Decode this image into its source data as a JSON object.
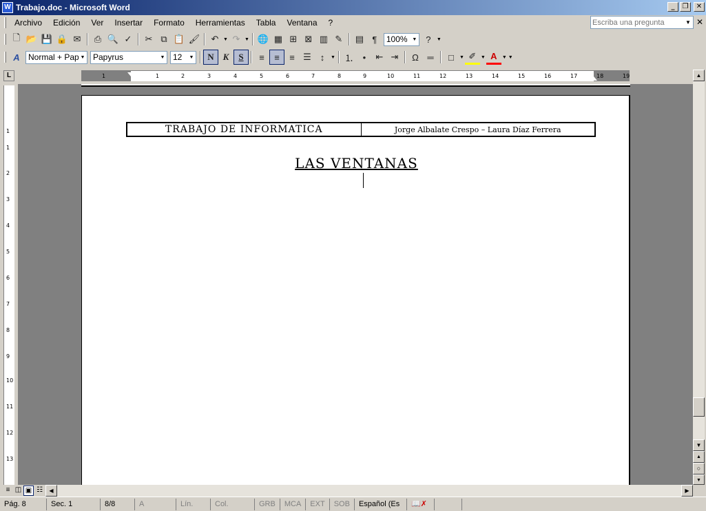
{
  "window": {
    "title": "Trabajo.doc - Microsoft Word",
    "app_icon": "W",
    "controls": {
      "minimize": "_",
      "restore": "❐",
      "close": "✕"
    }
  },
  "menu": {
    "items": [
      "Archivo",
      "Edición",
      "Ver",
      "Insertar",
      "Formato",
      "Herramientas",
      "Tabla",
      "Ventana",
      "?"
    ],
    "help_placeholder": "Escriba una pregunta",
    "doc_close": "✕"
  },
  "toolbar_standard": {
    "zoom": "100%"
  },
  "toolbar_format": {
    "style": "Normal + Papyr",
    "font": "Papyrus",
    "size": "12",
    "bold_label": "N",
    "italic_label": "K",
    "underline_label": "S"
  },
  "ruler": {
    "corner": "L",
    "marks": [
      "1",
      "1",
      "2",
      "3",
      "4",
      "5",
      "6",
      "7",
      "8",
      "9",
      "10",
      "11",
      "12",
      "13",
      "14",
      "15",
      "16",
      "17",
      "18",
      "19"
    ],
    "vmarks": [
      "1",
      "1",
      "2",
      "3",
      "4",
      "5",
      "6",
      "7",
      "8",
      "9",
      "10",
      "11",
      "12",
      "13"
    ]
  },
  "document": {
    "header_left": "TRABAJO DE INFORMATICA",
    "header_right": "Jorge Albalate Crespo – Laura Díaz Ferrera",
    "heading": "LAS VENTANAS"
  },
  "status": {
    "page": "Pág. 8",
    "section": "Sec. 1",
    "pages": "8/8",
    "at": "A",
    "line": "Lín.",
    "col": "Col.",
    "grb": "GRB",
    "mca": "MCA",
    "ext": "EXT",
    "sob": "SOB",
    "language": "Español (Es"
  }
}
